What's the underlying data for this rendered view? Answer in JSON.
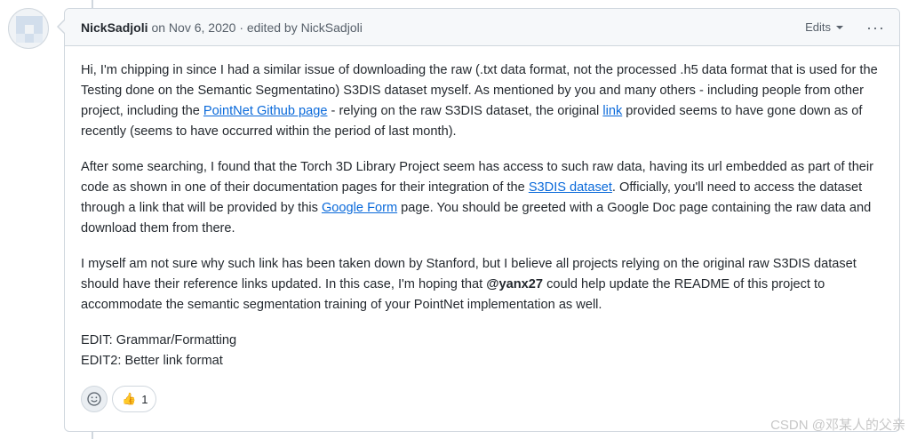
{
  "comment": {
    "author": "NickSadjoli",
    "meta": "on Nov 6, 2020 · edited by NickSadjoli",
    "edits_label": "Edits",
    "more_label": "···",
    "p1": {
      "t1": "Hi, I'm chipping in since I had a similar issue of downloading the raw (.txt data format, not the processed .h5 data format that is used for the Testing done on the Semantic Segmentatino) S3DIS dataset myself. As mentioned by you and many others - including people from other project, including the ",
      "link1": "PointNet Github page",
      "t2": " - relying on the raw S3DIS dataset, the original ",
      "link2": "link",
      "t3": " provided seems to have gone down as of recently (seems to have occurred within the period of last month)."
    },
    "p2": {
      "t1": "After some searching, I found that the Torch 3D Library Project seem has access to such raw data, having its url embedded as part of their code as shown in one of their documentation pages for their integration of the ",
      "link1": "S3DIS dataset",
      "t2": ". Officially, you'll need to access the dataset through a link that will be provided by this ",
      "link2": "Google Form",
      "t3": " page. You should be greeted with a Google Doc page containing the raw data and download them from there."
    },
    "p3": {
      "t1": "I myself am not sure why such link has been taken down by Stanford, but I believe all projects relying on the original raw S3DIS dataset should have their reference links updated. In this case, I'm hoping that ",
      "mention": "@yanx27",
      "t2": " could help update the README of this project to accommodate the semantic segmentation training of your PointNet implementation as well."
    },
    "edit1": "EDIT: Grammar/Formatting",
    "edit2": "EDIT2: Better link format",
    "reaction": {
      "emoji": "👍",
      "count": "1"
    }
  },
  "watermark": "CSDN @邓某人的父亲",
  "colors": {
    "link": "#0969da",
    "border": "#d0d7de",
    "header_bg": "#f6f8fa"
  }
}
